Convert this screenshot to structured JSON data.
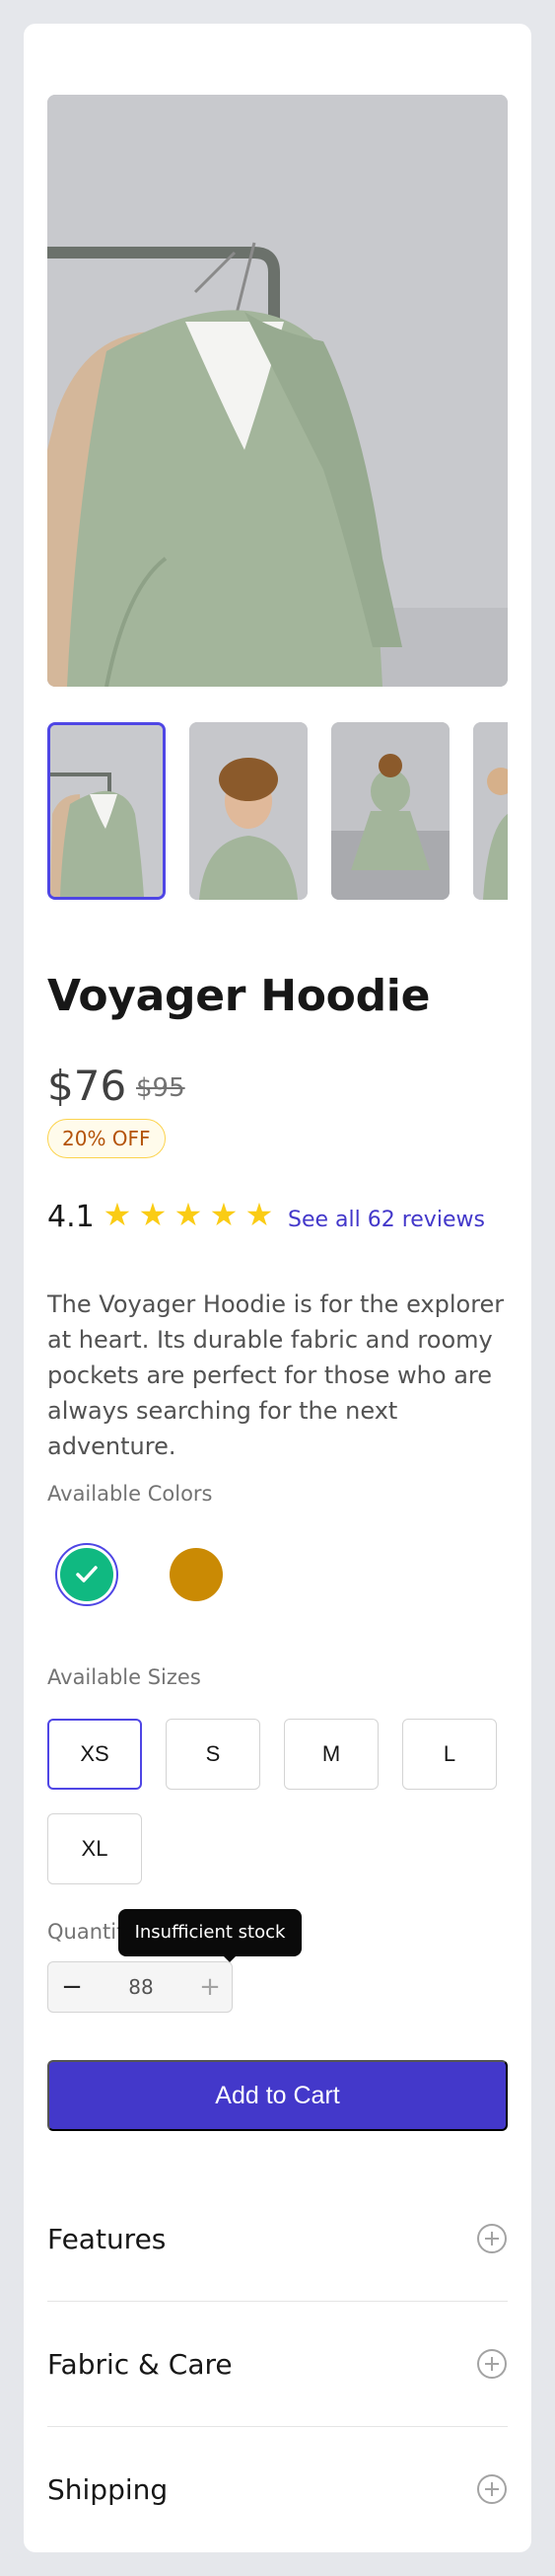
{
  "product": {
    "name": "Voyager Hoodie",
    "price": "$76",
    "original_price": "$95",
    "discount_badge": "20% OFF",
    "rating": "4.1",
    "stars_filled": 5,
    "reviews_link": "See all 62 reviews",
    "description": "The Voyager Hoodie is for the explorer at heart. Its durable fabric and roomy pockets are perfect for those who are always searching for the next adventure."
  },
  "images": {
    "main_alt": "Voyager Hoodie on rack",
    "thumbnails": [
      {
        "name": "thumbnail-rack",
        "selected": true
      },
      {
        "name": "thumbnail-portrait",
        "selected": false
      },
      {
        "name": "thumbnail-seated",
        "selected": false
      },
      {
        "name": "thumbnail-partial",
        "selected": false
      }
    ]
  },
  "colors": {
    "label": "Available Colors",
    "options": [
      {
        "name": "green",
        "hex": "#10b981",
        "selected": true
      },
      {
        "name": "amber",
        "hex": "#ca8a04",
        "selected": false
      }
    ]
  },
  "sizes": {
    "label": "Available Sizes",
    "options": [
      {
        "label": "XS",
        "selected": true
      },
      {
        "label": "S",
        "selected": false
      },
      {
        "label": "M",
        "selected": false
      },
      {
        "label": "L",
        "selected": false
      },
      {
        "label": "XL",
        "selected": false
      }
    ]
  },
  "quantity": {
    "label": "Quantity",
    "value": "88",
    "minus": "−",
    "plus": "+",
    "tooltip": "Insufficient stock"
  },
  "cart": {
    "add_label": "Add to Cart"
  },
  "accordion": [
    {
      "title": "Features"
    },
    {
      "title": "Fabric & Care"
    },
    {
      "title": "Shipping"
    }
  ],
  "colors_theme": {
    "accent": "#4338ca",
    "selected_border": "#4f46e5",
    "star": "#facc15"
  }
}
